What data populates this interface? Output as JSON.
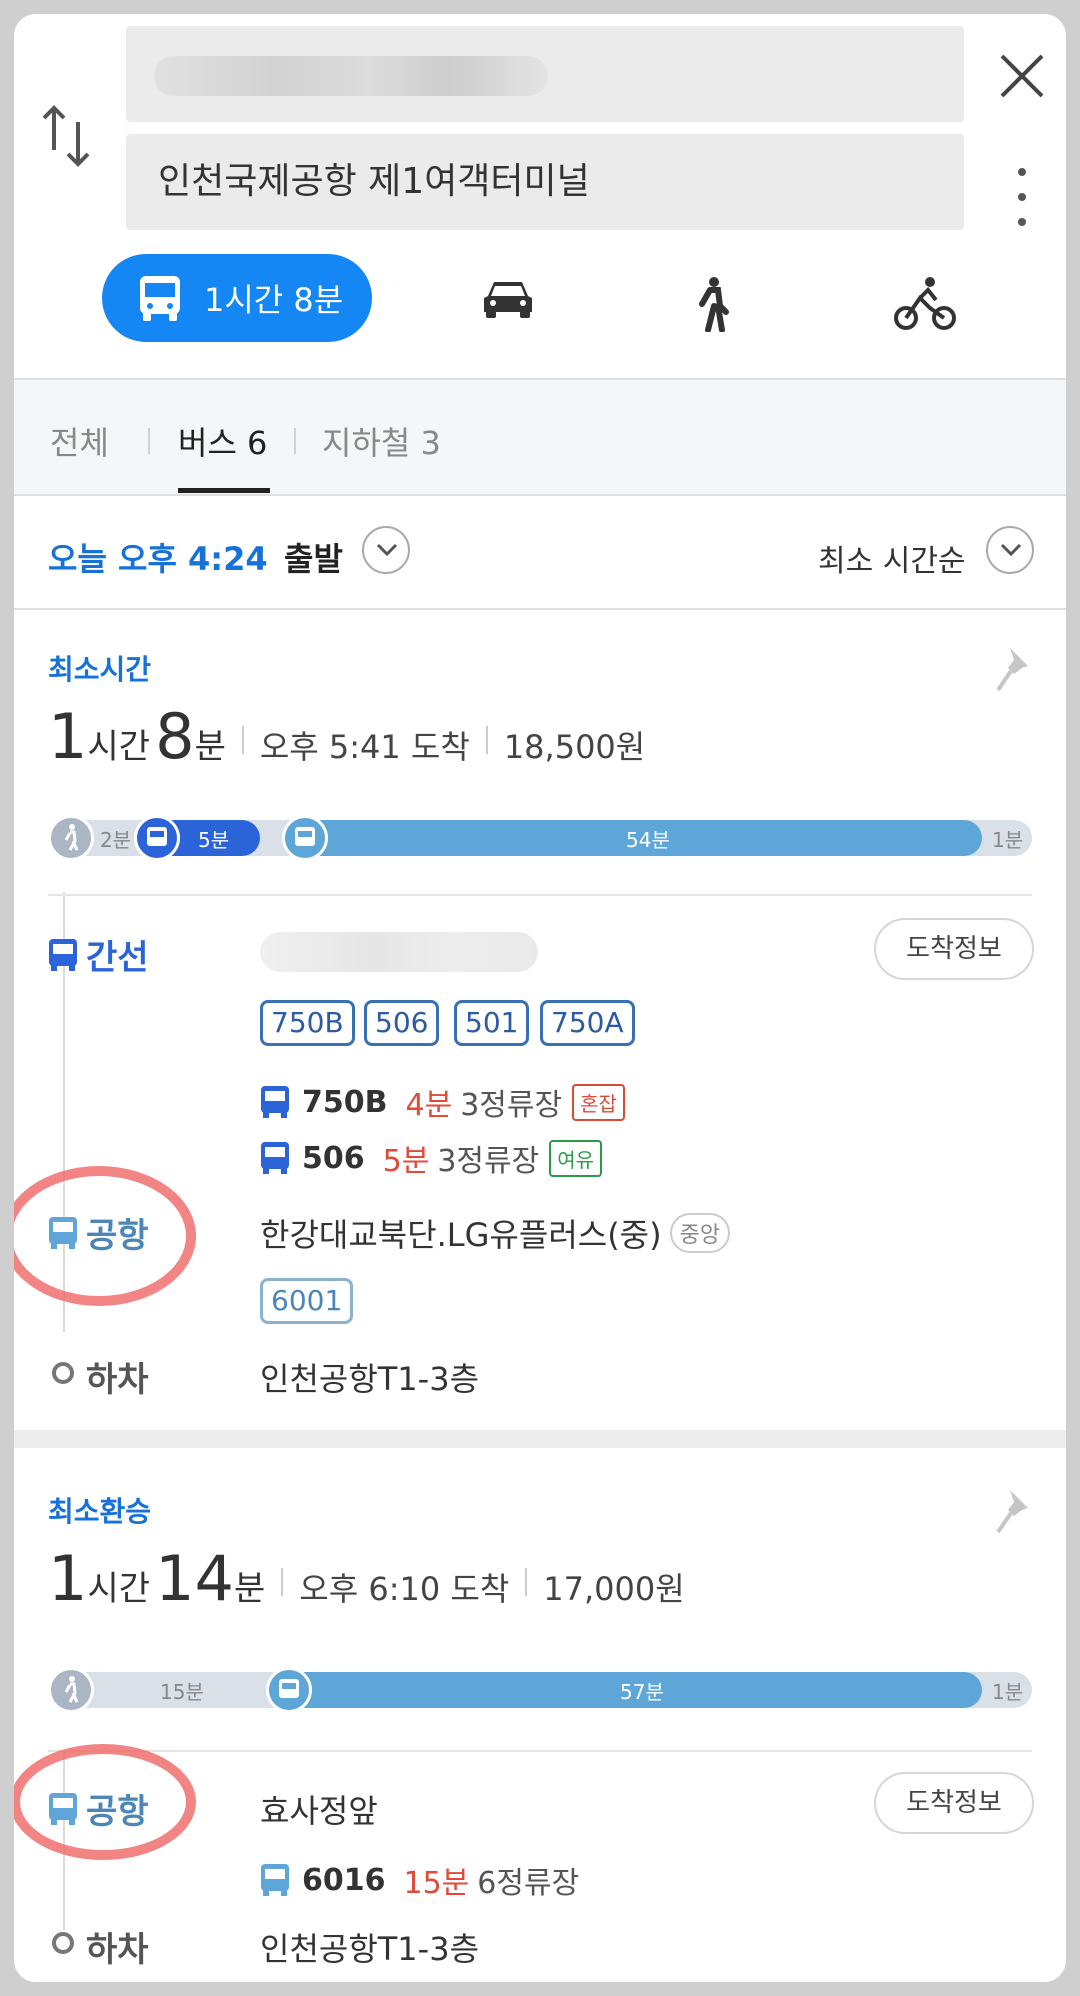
{
  "search": {
    "origin_value": "",
    "destination_value": "인천국제공항 제1여객터미널"
  },
  "modes": {
    "transit_label": "1시간 8분",
    "items": [
      "bus-icon",
      "car-icon",
      "walk-icon",
      "bike-icon"
    ]
  },
  "tabs": [
    {
      "label": "전체"
    },
    {
      "label": "버스 6"
    },
    {
      "label": "지하철 3"
    }
  ],
  "departure": {
    "time": "오늘 오후 4:24",
    "label": "출발",
    "sort_label": "최소 시간순"
  },
  "routes": [
    {
      "tag": "최소시간",
      "hours": "1",
      "hours_unit": "시간",
      "minutes": "8",
      "minutes_unit": "분",
      "arrival": "오후 5:41 도착",
      "fare": "18,500원",
      "bar": {
        "walk": "2분",
        "bus1": "5분",
        "bus2": "54분",
        "end": "1분"
      },
      "steps": [
        {
          "label": "간선",
          "info_button": "도착정보",
          "chips": [
            "750B",
            "506",
            "501",
            "750A"
          ],
          "arrivals": [
            {
              "number": "750B",
              "minutes": "4분",
              "stops": "3정류장",
              "status": "혼잡"
            },
            {
              "number": "506",
              "minutes": "5분",
              "stops": "3정류장",
              "status": "여유"
            }
          ]
        },
        {
          "label": "공항",
          "stop": "한강대교북단.LG유플러스(중)",
          "stop_tag": "중앙",
          "chips": [
            "6001"
          ]
        },
        {
          "label": "하차",
          "stop": "인천공항T1-3층"
        }
      ]
    },
    {
      "tag": "최소환승",
      "hours": "1",
      "hours_unit": "시간",
      "minutes": "14",
      "minutes_unit": "분",
      "arrival": "오후 6:10 도착",
      "fare": "17,000원",
      "bar": {
        "walk": "15분",
        "bus": "57분",
        "end": "1분"
      },
      "steps": [
        {
          "label": "공항",
          "stop": "효사정앞",
          "info_button": "도착정보",
          "arrivals": [
            {
              "number": "6016",
              "minutes": "15분",
              "stops": "6정류장"
            }
          ]
        },
        {
          "label": "하차",
          "stop": "인천공항T1-3층"
        }
      ]
    }
  ],
  "colors": {
    "accent": "#1487f5",
    "trunk_bus": "#2b63d9",
    "airport_bus": "#5fa6d8",
    "highlight": "#f16e6e"
  }
}
